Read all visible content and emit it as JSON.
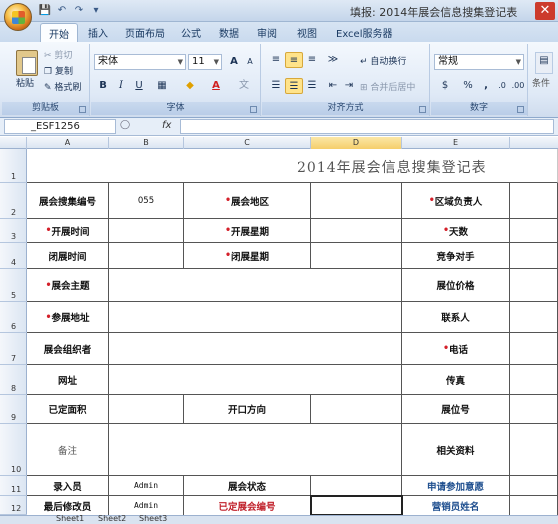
{
  "window": {
    "title": "填报: 2014年展会信息搜集登记表",
    "close_glyph": "✕"
  },
  "qat": [
    "💾",
    "↶",
    "↷",
    "▾"
  ],
  "ribbon_tabs": [
    "开始",
    "插入",
    "页面布局",
    "公式",
    "数据",
    "审阅",
    "视图",
    "Excel服务器"
  ],
  "ribbon": {
    "clipboard": {
      "paste": "粘贴",
      "cut": "剪切",
      "copy": "复制",
      "format_painter": "格式刷",
      "label": "剪贴板"
    },
    "font": {
      "name": "宋体",
      "size": "11",
      "grow": "A",
      "shrink": "A",
      "bold": "B",
      "italic": "I",
      "underline": "U",
      "label": "字体"
    },
    "alignment": {
      "wrap": "自动换行",
      "merge": "合并后居中",
      "label": "对齐方式"
    },
    "number": {
      "format": "常规",
      "percent": "%",
      "comma": ",",
      "label": "数字"
    },
    "styles_label": "条件"
  },
  "formula_bar": {
    "name_box": "_ESF1256",
    "fx": "fx",
    "value": ""
  },
  "columns": [
    "A",
    "B",
    "C",
    "D",
    "E"
  ],
  "rows": [
    "1",
    "2",
    "3",
    "4",
    "5",
    "6",
    "7",
    "8",
    "9",
    "10",
    "11",
    "12"
  ],
  "sheet": {
    "title": "2014年展会信息搜集登记表",
    "r2": {
      "a": "展会搜集编号",
      "b": "055",
      "c": "展会地区",
      "e": "区域负责人"
    },
    "r3": {
      "a": "开展时间",
      "c": "开展星期",
      "e": "天数"
    },
    "r4": {
      "a": "闭展时间",
      "c": "闭展星期",
      "e": "竞争对手"
    },
    "r5": {
      "a": "展会主题",
      "e": "展位价格"
    },
    "r6": {
      "a": "参展地址",
      "e": "联系人"
    },
    "r7": {
      "a": "展会组织者",
      "e": "电话"
    },
    "r8": {
      "a": "网址",
      "e": "传真"
    },
    "r9": {
      "a": "已定面积",
      "c": "开口方向",
      "e": "展位号"
    },
    "r10": {
      "a": "备注",
      "e": "相关资料"
    },
    "r11": {
      "a": "录入员",
      "b": "Admin",
      "c": "展会状态",
      "e": "申请参加意愿"
    },
    "r12": {
      "a": "最后修改员",
      "b": "Admin",
      "c": "已定展会编号",
      "e": "营销员姓名"
    },
    "star": "•"
  },
  "sheet_tabs": [
    "Sheet1",
    "Sheet2",
    "Sheet3"
  ],
  "colors": {
    "accent_red": "#c0202a",
    "blue_label": "#1f4f8f",
    "ribbon_bg": "#dfe9f6"
  }
}
